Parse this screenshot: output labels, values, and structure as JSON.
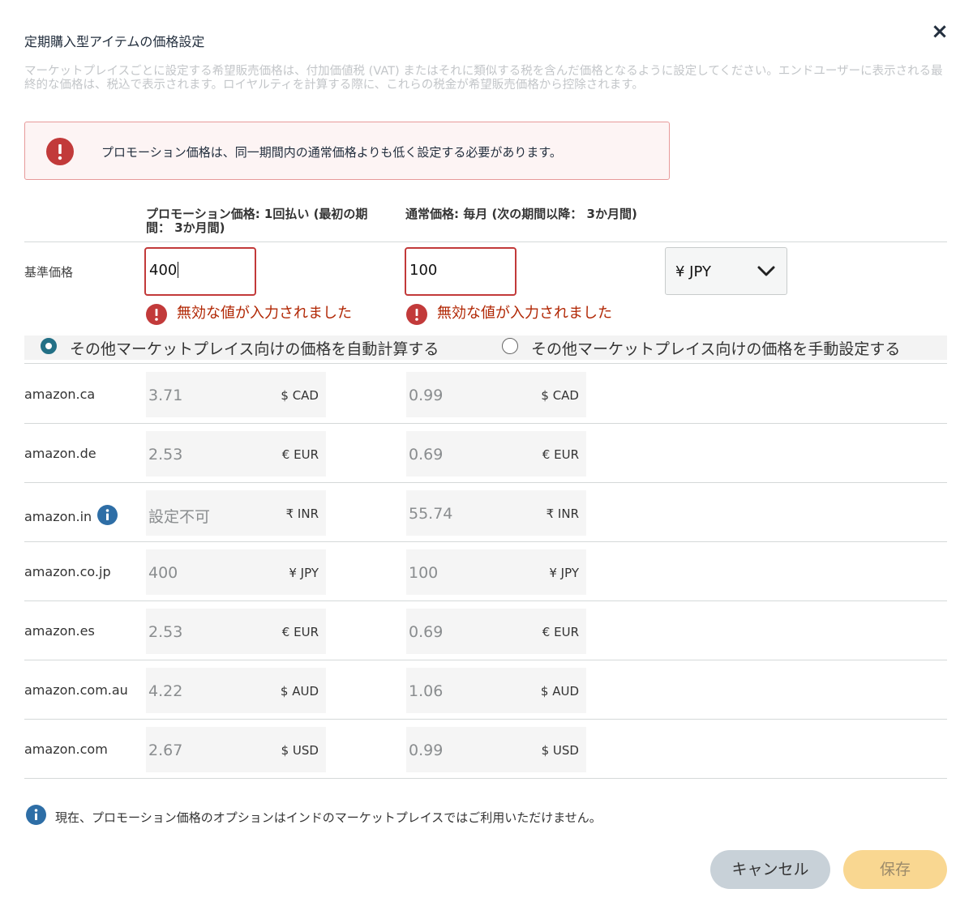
{
  "dialog": {
    "title": "定期購入型アイテムの価格設定",
    "close_label": "×",
    "description": "マーケットプレイスごとに設定する希望販売価格は、付加価値税 (VAT) またはそれに類似する税を含んだ価格となるように設定してください。エンドユーザーに表示される最終的な価格は、税込で表示されます。ロイヤルティを計算する際に、これらの税金が希望販売価格から控除されます。"
  },
  "alert": {
    "icon": "error-icon",
    "text": "プロモーション価格は、同一期間内の通常価格よりも低く設定する必要があります。"
  },
  "columns": {
    "promo_header": "プロモーション価格: 1回払い (最初の期間： 3か月間)",
    "regular_header": "通常価格: 毎月 (次の期間以降： 3か月間)"
  },
  "base_price": {
    "label": "基準価格",
    "promo_value": "400",
    "regular_value": "100",
    "currency": "¥ JPY",
    "promo_error": "無効な値が入力されました",
    "regular_error": "無効な値が入力されました"
  },
  "radios": {
    "auto_label": "その他マーケットプレイス向けの価格を自動計算する",
    "auto_selected": true,
    "manual_label": "その他マーケットプレイス向けの価格を手動設定する",
    "manual_selected": false
  },
  "marketplaces": [
    {
      "name": "amazon.ca",
      "promo": "3.71",
      "promo_currency": "$ CAD",
      "regular": "0.99",
      "regular_currency": "$ CAD"
    },
    {
      "name": "amazon.de",
      "promo": "2.53",
      "promo_currency": "€ EUR",
      "regular": "0.69",
      "regular_currency": "€ EUR"
    },
    {
      "name": "amazon.in",
      "info_icon": true,
      "promo": "設定不可",
      "promo_currency": "₹ INR",
      "regular": "55.74",
      "regular_currency": "₹ INR"
    },
    {
      "name": "amazon.co.jp",
      "promo": "400",
      "promo_currency": "¥ JPY",
      "regular": "100",
      "regular_currency": "¥ JPY"
    },
    {
      "name": "amazon.es",
      "promo": "2.53",
      "promo_currency": "€ EUR",
      "regular": "0.69",
      "regular_currency": "€ EUR"
    },
    {
      "name": "amazon.com.au",
      "promo": "4.22",
      "promo_currency": "$ AUD",
      "regular": "1.06",
      "regular_currency": "$ AUD"
    },
    {
      "name": "amazon.com",
      "promo": "2.67",
      "promo_currency": "$ USD",
      "regular": "0.99",
      "regular_currency": "$ USD"
    }
  ],
  "footer": {
    "info_text": "現在、プロモーション価格のオプションはインドのマーケットプレイスではご利用いただけません。",
    "cancel_label": "キャンセル",
    "save_label": "保存"
  },
  "colors": {
    "error": "#b12704",
    "error_icon": "#c23a3a",
    "info_icon": "#2e6ea6",
    "radio_selected": "#237086",
    "save_button": "#f9d791",
    "cancel_button": "#c8d1d8"
  }
}
